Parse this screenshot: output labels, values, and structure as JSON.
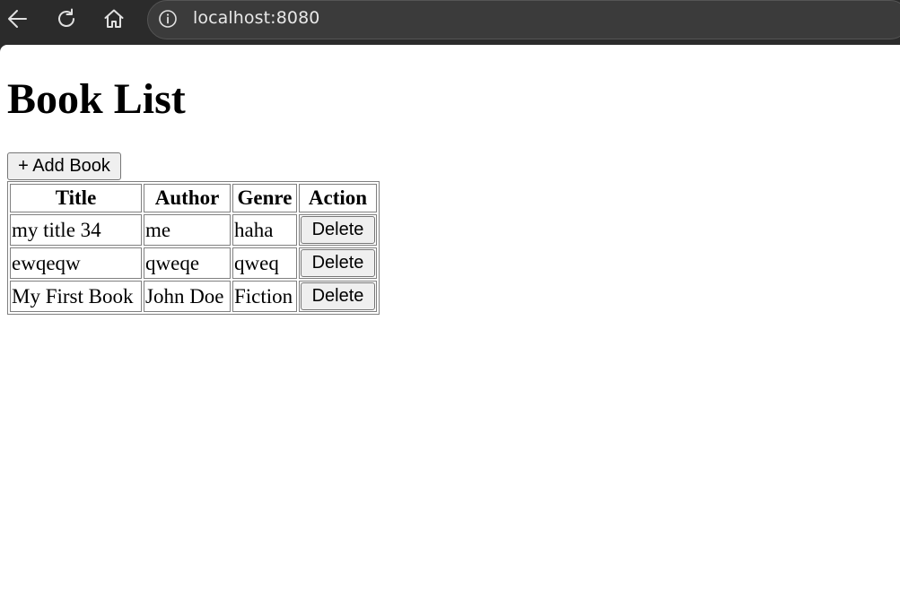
{
  "browser": {
    "url": "localhost:8080",
    "icons": [
      "back-arrow-icon",
      "reload-icon",
      "home-icon",
      "info-icon"
    ]
  },
  "page": {
    "title": "Book List",
    "add_button_label": "+ Add Book"
  },
  "table": {
    "headers": [
      "Title",
      "Author",
      "Genre",
      "Action"
    ],
    "rows": [
      {
        "title": "my title 34",
        "author": "me",
        "genre": "haha",
        "action": "Delete"
      },
      {
        "title": "ewqeqw",
        "author": "qweqe",
        "genre": "qweq",
        "action": "Delete"
      },
      {
        "title": "My First Book",
        "author": "John Doe",
        "genre": "Fiction",
        "action": "Delete"
      }
    ]
  }
}
